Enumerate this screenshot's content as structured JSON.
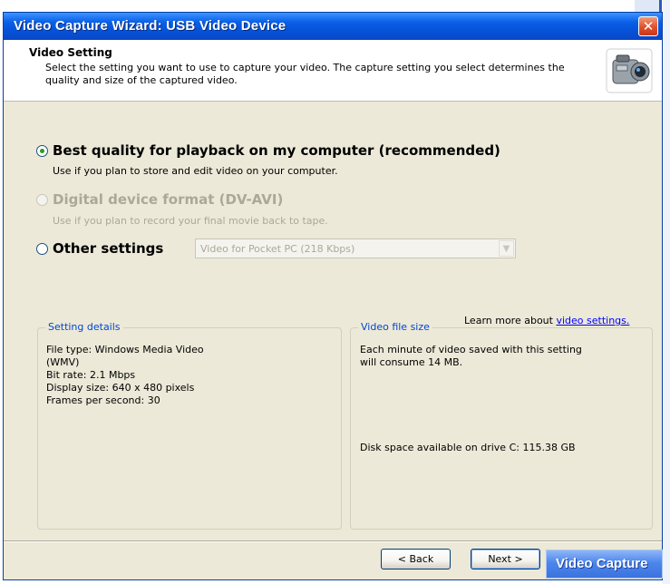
{
  "window": {
    "title": "Video Capture Wizard: USB Video Device",
    "close_glyph": "✕"
  },
  "header": {
    "title": "Video Setting",
    "description": "Select the setting you want to use to capture your video. The capture setting you select determines the quality and size of the captured video.",
    "icon": "video-camera-icon"
  },
  "options": [
    {
      "label": "Best quality for playback on my computer (recommended)",
      "description": "Use if you plan to store and edit video on your computer.",
      "selected": true,
      "enabled": true
    },
    {
      "label": "Digital device format (DV-AVI)",
      "description": "Use if you plan to record your final movie back to tape.",
      "selected": false,
      "enabled": false
    },
    {
      "label": "Other settings",
      "selected": false,
      "enabled": true
    }
  ],
  "other_settings_select": {
    "value": "Video for Pocket PC (218 Kbps)",
    "enabled": false
  },
  "learn_more": {
    "prefix": "Learn more about ",
    "link": "video settings."
  },
  "setting_details": {
    "legend": "Setting details",
    "file_type_line1": "File type: Windows Media Video",
    "file_type_line2": "(WMV)",
    "bit_rate": "Bit rate: 2.1 Mbps",
    "display_size": "Display size: 640 x 480 pixels",
    "frames_per_second": "Frames per second: 30"
  },
  "video_file_size": {
    "legend": "Video file size",
    "line1": "Each minute of video saved with this setting",
    "line2": "will consume 14 MB.",
    "disk_space": "Disk space available on drive C: 115.38 GB"
  },
  "buttons": {
    "back": "< Back",
    "next": "Next >"
  },
  "taskbar": {
    "label": "Video Capture"
  },
  "colors": {
    "title_bar": "#0551d8",
    "dialog_bg": "#ece9d8",
    "legend_text": "#0046d5",
    "link": "#0000ff",
    "disabled_text": "#aca899",
    "radio_dot": "#21a121"
  }
}
